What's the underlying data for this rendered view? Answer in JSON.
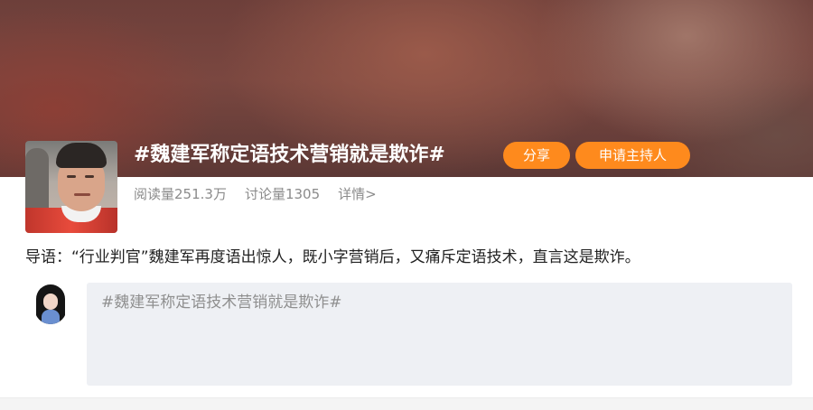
{
  "topic": {
    "title": "#魏建军称定语技术营销就是欺诈#",
    "share_label": "分享",
    "host_label": "申请主持人"
  },
  "stats": {
    "reads": "阅读量251.3万",
    "discussions": "讨论量1305",
    "detail": "详情>"
  },
  "intro": {
    "text": "导语：“行业判官”魏建军再度语出惊人，既小字营销后，又痛斥定语技术，直言这是欺诈。"
  },
  "composer": {
    "text": "#魏建军称定语技术营销就是欺诈#"
  },
  "colors": {
    "accent": "#fe8a1d",
    "banner": "#6d3f3a",
    "muted_text": "#8b8b8b",
    "composer_bg": "#eef0f4"
  }
}
